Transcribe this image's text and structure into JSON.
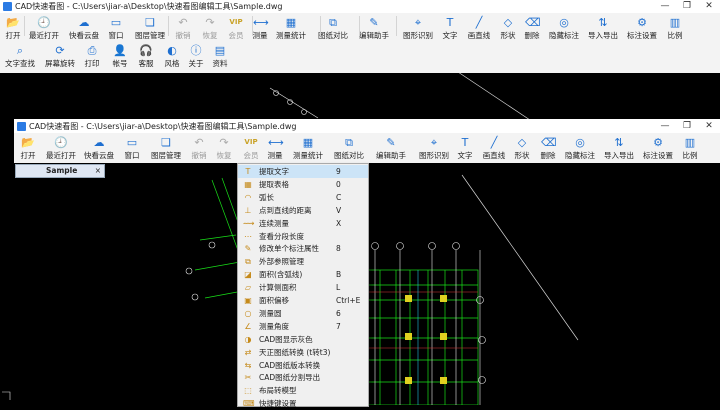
{
  "colors": {
    "canvas": "#000000",
    "cad_green": "#18e018",
    "cad_white": "#e8e8e8",
    "cad_red": "#e03a3a",
    "cad_yellow": "#e0d020",
    "cad_cyan": "#20c0e0",
    "accent": "#2b7be4"
  },
  "outer_window": {
    "title": "CAD快速看图 - C:\\Users\\jiar-a\\Desktop\\快速看图编辑工具\\Sample.dwg",
    "controls": [
      "—",
      "❐",
      "✕"
    ],
    "toolbar_row1": [
      {
        "label": "打开",
        "icon": "open-folder-icon",
        "glyph": "📂"
      },
      {
        "label": "最近打开",
        "icon": "recent-icon",
        "glyph": "🕘"
      },
      {
        "label": "快看云盘",
        "icon": "cloud-icon",
        "glyph": "☁"
      },
      {
        "label": "窗口",
        "icon": "window-icon",
        "glyph": "▭"
      },
      {
        "label": "图层管理",
        "icon": "layers-icon",
        "glyph": "❏"
      },
      {
        "label": "撤销",
        "icon": "undo-icon",
        "glyph": "↶",
        "disabled": true
      },
      {
        "label": "恢复",
        "icon": "redo-icon",
        "glyph": "↷",
        "disabled": true
      },
      {
        "label": "会员",
        "icon": "vip-icon",
        "glyph": "VIP",
        "disabled": true
      },
      {
        "label": "测量",
        "icon": "measure-icon",
        "glyph": "⟷"
      },
      {
        "label": "测量统计",
        "icon": "measure-stats-icon",
        "glyph": "▦"
      },
      {
        "label": "图纸对比",
        "icon": "compare-icon",
        "glyph": "⧉"
      },
      {
        "label": "编辑助手",
        "icon": "edit-assistant-icon",
        "glyph": "✎"
      },
      {
        "label": "图形识别",
        "icon": "recognize-icon",
        "glyph": "⌖"
      },
      {
        "label": "文字",
        "icon": "text-icon",
        "glyph": "T"
      },
      {
        "label": "画直线",
        "icon": "line-icon",
        "glyph": "╱"
      },
      {
        "label": "形状",
        "icon": "shape-icon",
        "glyph": "◇"
      },
      {
        "label": "删除",
        "icon": "eraser-icon",
        "glyph": "⌫"
      },
      {
        "label": "隐藏标注",
        "icon": "hide-annotation-icon",
        "glyph": "◎"
      },
      {
        "label": "导入导出",
        "icon": "import-export-icon",
        "glyph": "⇅"
      },
      {
        "label": "标注设置",
        "icon": "annotation-settings-icon",
        "glyph": "⚙"
      },
      {
        "label": "比例",
        "icon": "scale-icon",
        "glyph": "▥"
      }
    ],
    "toolbar_row2": [
      {
        "label": "文字查找",
        "icon": "text-search-icon",
        "glyph": "⌕"
      },
      {
        "label": "屏幕旋转",
        "icon": "rotate-screen-icon",
        "glyph": "⟳"
      },
      {
        "label": "打印",
        "icon": "print-icon",
        "glyph": "⎙"
      },
      {
        "label": "帐号",
        "icon": "account-icon",
        "glyph": "👤"
      },
      {
        "label": "客服",
        "icon": "support-icon",
        "glyph": "🎧"
      },
      {
        "label": "风格",
        "icon": "style-icon",
        "glyph": "◐"
      },
      {
        "label": "关于",
        "icon": "about-icon",
        "glyph": "ⓘ"
      },
      {
        "label": "资料",
        "icon": "docs-icon",
        "glyph": "▤"
      }
    ]
  },
  "inner_window": {
    "title": "CAD快速看图 - C:\\Users\\jiar-a\\Desktop\\快速看图编辑工具\\Sample.dwg",
    "controls": [
      "—",
      "❐",
      "✕"
    ],
    "tab_label": "Sample",
    "tab_close": "×",
    "toolbar": [
      {
        "label": "打开",
        "icon": "open-folder-icon",
        "glyph": "📂"
      },
      {
        "label": "最近打开",
        "icon": "recent-icon",
        "glyph": "🕘"
      },
      {
        "label": "快看云盘",
        "icon": "cloud-icon",
        "glyph": "☁"
      },
      {
        "label": "窗口",
        "icon": "window-icon",
        "glyph": "▭"
      },
      {
        "label": "图层管理",
        "icon": "layers-icon",
        "glyph": "❏"
      },
      {
        "label": "撤销",
        "icon": "undo-icon",
        "glyph": "↶",
        "disabled": true
      },
      {
        "label": "恢复",
        "icon": "redo-icon",
        "glyph": "↷",
        "disabled": true
      },
      {
        "label": "会员",
        "icon": "vip-icon",
        "glyph": "VIP",
        "disabled": true
      },
      {
        "label": "测量",
        "icon": "measure-icon",
        "glyph": "⟷"
      },
      {
        "label": "测量统计",
        "icon": "measure-stats-icon",
        "glyph": "▦"
      },
      {
        "label": "图纸对比",
        "icon": "compare-icon",
        "glyph": "⧉"
      },
      {
        "label": "编辑助手",
        "icon": "edit-assistant-icon",
        "glyph": "✎"
      },
      {
        "label": "图形识别",
        "icon": "recognize-icon",
        "glyph": "⌖"
      },
      {
        "label": "文字",
        "icon": "text-icon",
        "glyph": "T"
      },
      {
        "label": "画直线",
        "icon": "line-icon",
        "glyph": "╱"
      },
      {
        "label": "形状",
        "icon": "shape-icon",
        "glyph": "◇"
      },
      {
        "label": "删除",
        "icon": "eraser-icon",
        "glyph": "⌫"
      },
      {
        "label": "隐藏标注",
        "icon": "hide-annotation-icon",
        "glyph": "◎"
      },
      {
        "label": "导入导出",
        "icon": "import-export-icon",
        "glyph": "⇅"
      },
      {
        "label": "标注设置",
        "icon": "annotation-settings-icon",
        "glyph": "⚙"
      },
      {
        "label": "比例",
        "icon": "scale-icon",
        "glyph": "▥"
      }
    ]
  },
  "measure_menu": [
    {
      "label": "提取文字",
      "shortcut": "9",
      "icon": "extract-text-icon",
      "glyph": "T"
    },
    {
      "label": "提取表格",
      "shortcut": "0",
      "icon": "extract-table-icon",
      "glyph": "▦"
    },
    {
      "label": "弧长",
      "shortcut": "C",
      "icon": "arc-length-icon",
      "glyph": "◠"
    },
    {
      "label": "点到直线的距离",
      "shortcut": "V",
      "icon": "point-line-distance-icon",
      "glyph": "⊥"
    },
    {
      "label": "连续测量",
      "shortcut": "X",
      "icon": "continuous-measure-icon",
      "glyph": "⟿"
    },
    {
      "label": "查看分段长度",
      "shortcut": "",
      "icon": "segment-length-icon",
      "glyph": "⋯"
    },
    {
      "label": "修改单个标注属性",
      "shortcut": "8",
      "icon": "edit-annotation-icon",
      "glyph": "✎"
    },
    {
      "label": "外部参照管理",
      "shortcut": "",
      "icon": "xref-icon",
      "glyph": "⧉"
    },
    {
      "label": "面积(含弧线)",
      "shortcut": "B",
      "icon": "area-arc-icon",
      "glyph": "◪"
    },
    {
      "label": "计算侧面积",
      "shortcut": "L",
      "icon": "side-area-icon",
      "glyph": "▱"
    },
    {
      "label": "面积偏移",
      "shortcut": "Ctrl+E",
      "icon": "area-offset-icon",
      "glyph": "▣"
    },
    {
      "label": "测量圆",
      "shortcut": "6",
      "icon": "measure-circle-icon",
      "glyph": "○"
    },
    {
      "label": "测量角度",
      "shortcut": "7",
      "icon": "measure-angle-icon",
      "glyph": "∠"
    },
    {
      "label": "CAD图显示灰色",
      "shortcut": "",
      "icon": "gray-display-icon",
      "glyph": "◑"
    },
    {
      "label": "天正图纸转换 (t转t3)",
      "shortcut": "",
      "icon": "tangent-convert-icon",
      "glyph": "⇄"
    },
    {
      "label": "CAD图纸版本转换",
      "shortcut": "",
      "icon": "version-convert-icon",
      "glyph": "⇆"
    },
    {
      "label": "CAD图纸分割导出",
      "shortcut": "",
      "icon": "split-export-icon",
      "glyph": "✂"
    },
    {
      "label": "布局转模型",
      "shortcut": "",
      "icon": "layout-to-model-icon",
      "glyph": "⬚"
    },
    {
      "label": "快捷键设置",
      "shortcut": "",
      "icon": "shortcut-settings-icon",
      "glyph": "⌨"
    }
  ]
}
